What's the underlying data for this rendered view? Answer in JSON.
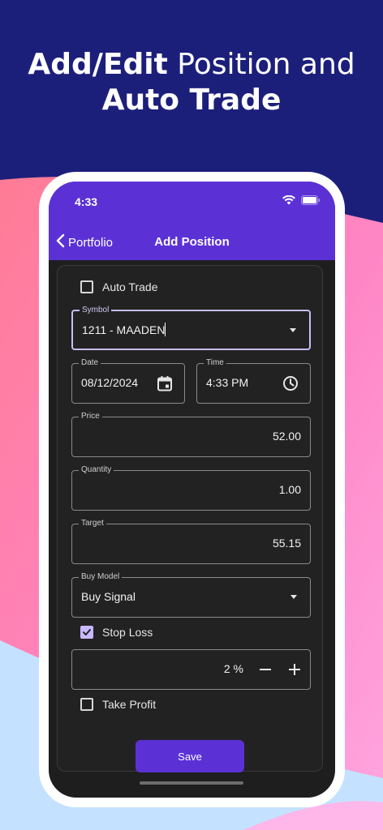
{
  "headline": {
    "bold_1": "Add/Edit",
    "normal_1": " Position and",
    "bold_2": "Auto Trade"
  },
  "status_bar": {
    "time": "4:33"
  },
  "nav": {
    "back_label": "Portfolio",
    "title": "Add Position"
  },
  "form": {
    "auto_trade": {
      "label": "Auto Trade",
      "checked": false
    },
    "symbol": {
      "label": "Symbol",
      "value": "1211 - MAADEN"
    },
    "date": {
      "label": "Date",
      "value": "08/12/2024"
    },
    "time": {
      "label": "Time",
      "value": "4:33 PM"
    },
    "price": {
      "label": "Price",
      "value": "52.00"
    },
    "quantity": {
      "label": "Quantity",
      "value": "1.00"
    },
    "target": {
      "label": "Target",
      "value": "55.15"
    },
    "buy_model": {
      "label": "Buy Model",
      "value": "Buy Signal"
    },
    "stop_loss": {
      "label": "Stop Loss",
      "checked": true,
      "value": "2 %"
    },
    "take_profit": {
      "label": "Take Profit",
      "checked": false
    },
    "save_label": "Save"
  },
  "colors": {
    "accent": "#5b31d6",
    "background_top": "#1c1f7a",
    "pink": "#ff7fa6",
    "light_blue": "#bfe3ff"
  },
  "icons": [
    "chevron-left-icon",
    "wifi-icon",
    "battery-icon",
    "signal-icon",
    "calendar-icon",
    "clock-icon",
    "dropdown-caret-icon",
    "minus-icon",
    "plus-icon",
    "checkmark-icon"
  ]
}
